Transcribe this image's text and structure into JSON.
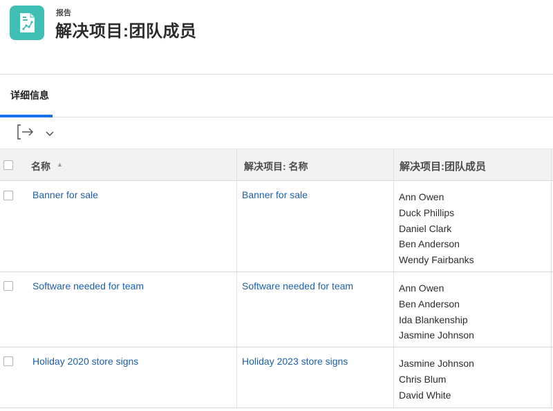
{
  "header": {
    "subtitle": "报告",
    "title": "解决项目:团队成员"
  },
  "tabs": [
    {
      "label": "详细信息"
    }
  ],
  "table": {
    "columns": {
      "name": "名称",
      "resolve_name": "解决项目: 名称",
      "resolve_team": "解决项目:团队成员"
    },
    "rows": [
      {
        "name": "Banner for sale",
        "resolve_name": "Banner for sale",
        "members": [
          "Ann Owen",
          "Duck Phillips",
          "Daniel Clark",
          "Ben Anderson",
          "Wendy Fairbanks"
        ]
      },
      {
        "name": "Software needed for team",
        "resolve_name": "Software needed for team",
        "members": [
          "Ann Owen",
          "Ben Anderson",
          "Ida Blankenship",
          "Jasmine Johnson"
        ]
      },
      {
        "name": "Holiday 2020 store signs",
        "resolve_name": "Holiday 2023 store signs",
        "members": [
          "Jasmine Johnson",
          "Chris Blum",
          "David White"
        ]
      }
    ]
  },
  "colors": {
    "icon_bg": "#3fbfb3",
    "link": "#1d5fa8",
    "tab_underline": "#1473e6"
  }
}
